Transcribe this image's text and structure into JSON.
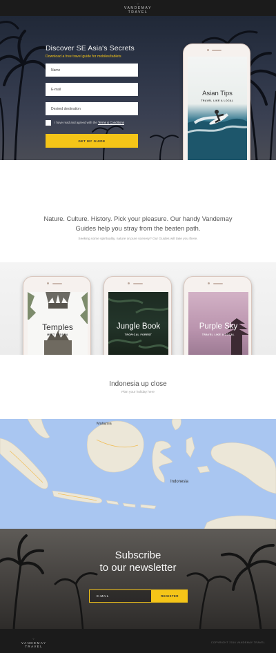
{
  "brand": {
    "name_line1": "VANDEMAY",
    "name_line2": "TRAVEL",
    "mark": "⁘"
  },
  "hero": {
    "title": "Discover SE Asia's Secrets",
    "subtitle": "Download a free travel guide for mobiles/tablets",
    "fields": {
      "name_placeholder": "Name",
      "email_placeholder": "E-mail",
      "destination_placeholder": "Desired destination"
    },
    "consent_text": "I have read and agreed with the ",
    "consent_link": "Terms & Conditions",
    "cta_label": "GET MY GUIDE",
    "phone": {
      "title": "Asian Tips",
      "subtitle": "TRAVEL LIKE A LOCAL"
    }
  },
  "guides": {
    "headline_line1": "Nature. Culture. History. Pick your pleasure. Our handy Vandemay",
    "headline_line2": "Guides help you stray from the beaten path.",
    "subline": "Seeking some spirituality, nature or pure scenery? Our Guides will take you there.",
    "items": [
      {
        "title": "Temples",
        "subtitle": "MEET BUDDHA"
      },
      {
        "title": "Jungle Book",
        "subtitle": "TROPICAL FOREST"
      },
      {
        "title": "Purple Sky",
        "subtitle": "TRAVEL LIKE A LOCAL"
      }
    ]
  },
  "indonesia": {
    "title": "Indonesia up close",
    "subtitle": "Plan your holiday here",
    "map_labels": {
      "malaysia": "Malaysia",
      "indonesia": "Indonesia"
    }
  },
  "newsletter": {
    "title_line1": "Subscribe",
    "title_line2": "to our newsletter",
    "email_placeholder": "E-MAIL",
    "register_label": "REGISTER"
  },
  "footer": {
    "copyright": "COPYRIGHT 2016 VANDEMAY TRAVEL"
  },
  "colors": {
    "accent": "#f5c518",
    "dark": "#1b1b1b",
    "map_water": "#a9c6f1",
    "map_land": "#e9e4d6"
  }
}
